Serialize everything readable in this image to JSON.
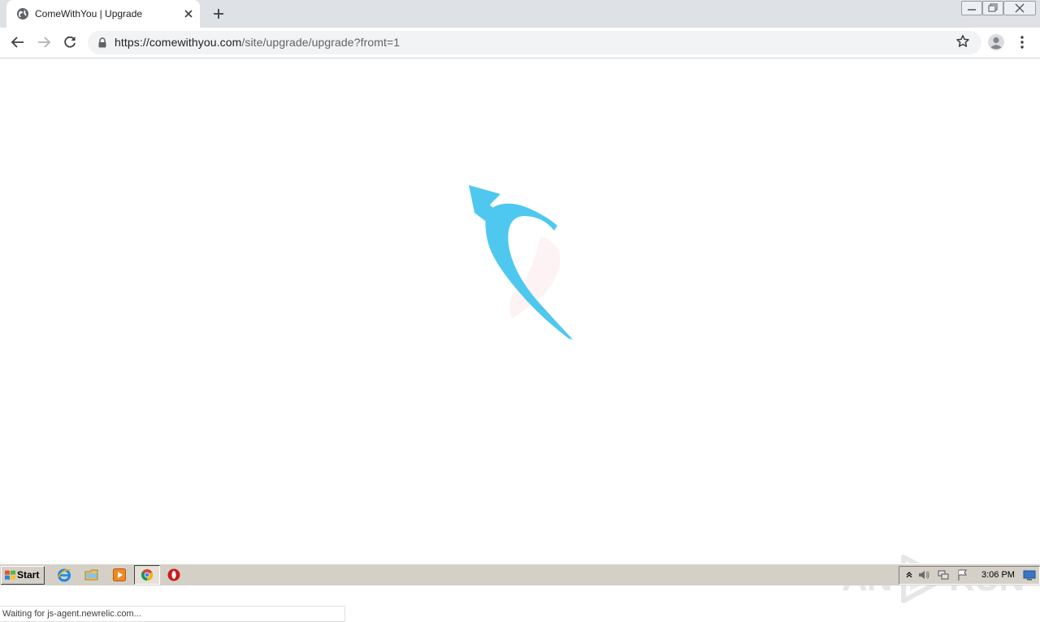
{
  "browser": {
    "tab": {
      "title": "ComeWithYou | Upgrade",
      "favicon": "globe-icon"
    },
    "address_bar": {
      "url_host": "https://comewithyou.com",
      "url_path": "/site/upgrade/upgrade?fromt=1"
    }
  },
  "page": {
    "loader": {
      "icon": "loading-arrow-logo",
      "color": "#4fc8ef"
    },
    "status_text": "Waiting for js-agent.newrelic.com..."
  },
  "watermark": {
    "left": "ANY",
    "right": "RUN"
  },
  "taskbar": {
    "start_label": "Start",
    "pinned": [
      "internet-explorer-icon",
      "file-explorer-icon",
      "media-player-icon",
      "chrome-icon",
      "opera-icon"
    ],
    "clock": "3:06 PM"
  },
  "colors": {
    "tabstrip": "#dee1e6",
    "omnibox": "#f1f3f4",
    "accent": "#4fc8ef",
    "taskbar": "#d4d0c8"
  }
}
